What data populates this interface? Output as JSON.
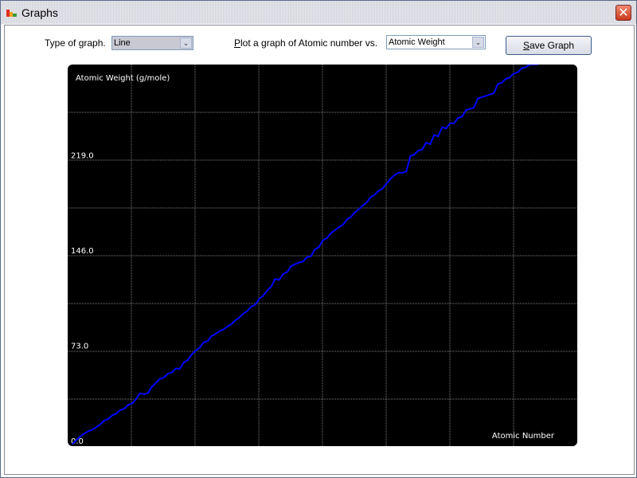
{
  "window": {
    "title": "Graphs",
    "icon": "graph-app-icon",
    "close_icon": "close-icon",
    "close_glyph": "✕"
  },
  "controls": {
    "type_label_prefix": "Type of ",
    "type_label_mnemonic": "g",
    "type_label_suffix": "raph.",
    "type_value": "Line",
    "plot_label_mnemonic": "P",
    "plot_label_suffix": "lot a graph of Atomic number vs.",
    "plot_value": "Atomic Weight",
    "save_mnemonic": "S",
    "save_suffix": "ave Graph",
    "dropdown_glyph": "⌄"
  },
  "colors": {
    "plot_bg": "#000000",
    "line": "#0000ff",
    "grid": "#808080",
    "text": "#ffffff"
  },
  "chart_data": {
    "type": "line",
    "title": "",
    "xlabel": "Atomic Number",
    "ylabel": "Atomic Weight (g/mole)",
    "y_tick_labels": [
      "0.0",
      "73.0",
      "146.0",
      "219.0"
    ],
    "y_ticks": [
      0,
      73,
      146,
      219
    ],
    "ylim": [
      0,
      292
    ],
    "xlim": [
      0,
      128
    ],
    "grid": true,
    "x": [
      1,
      2,
      3,
      4,
      5,
      6,
      7,
      8,
      9,
      10,
      11,
      12,
      13,
      14,
      15,
      16,
      17,
      18,
      19,
      20,
      21,
      22,
      23,
      24,
      25,
      26,
      27,
      28,
      29,
      30,
      31,
      32,
      33,
      34,
      35,
      36,
      37,
      38,
      39,
      40,
      41,
      42,
      43,
      44,
      45,
      46,
      47,
      48,
      49,
      50,
      51,
      52,
      53,
      54,
      55,
      56,
      57,
      58,
      59,
      60,
      61,
      62,
      63,
      64,
      65,
      66,
      67,
      68,
      69,
      70,
      71,
      72,
      73,
      74,
      75,
      76,
      77,
      78,
      79,
      80,
      81,
      82,
      83,
      84,
      85,
      86,
      87,
      88,
      89,
      90,
      91,
      92,
      93,
      94,
      95,
      96,
      97,
      98,
      99,
      100,
      101,
      102,
      103,
      104,
      105,
      106,
      107,
      108,
      109,
      110,
      111,
      112,
      113,
      114,
      115,
      116,
      117,
      118
    ],
    "series": [
      {
        "name": "Atomic Weight",
        "values": [
          1.008,
          4.003,
          6.94,
          9.012,
          10.81,
          12.011,
          14.007,
          15.999,
          18.998,
          20.18,
          22.99,
          24.305,
          26.982,
          28.085,
          30.974,
          32.06,
          35.45,
          39.95,
          39.098,
          40.078,
          44.956,
          47.867,
          50.942,
          51.996,
          54.938,
          55.845,
          58.933,
          58.693,
          63.546,
          65.38,
          69.723,
          72.63,
          74.922,
          78.971,
          79.904,
          83.798,
          85.468,
          87.62,
          88.906,
          91.224,
          92.906,
          95.95,
          98,
          101.07,
          102.91,
          106.42,
          107.87,
          112.41,
          114.82,
          118.71,
          121.76,
          127.6,
          126.9,
          131.29,
          132.91,
          137.33,
          138.91,
          140.12,
          140.91,
          144.24,
          145,
          150.36,
          151.96,
          157.25,
          158.93,
          162.5,
          164.93,
          167.26,
          168.93,
          173.05,
          174.97,
          178.49,
          180.95,
          183.84,
          186.21,
          190.23,
          192.22,
          195.08,
          196.97,
          200.59,
          204.38,
          207.2,
          208.98,
          209,
          210,
          222,
          223,
          226,
          227,
          232.04,
          231.04,
          238.03,
          237,
          244,
          243,
          247,
          247,
          251,
          252,
          257,
          258,
          259,
          266,
          267,
          268,
          269,
          270,
          277,
          278,
          281,
          282,
          285,
          286,
          289,
          290,
          293,
          294,
          294
        ]
      }
    ]
  }
}
